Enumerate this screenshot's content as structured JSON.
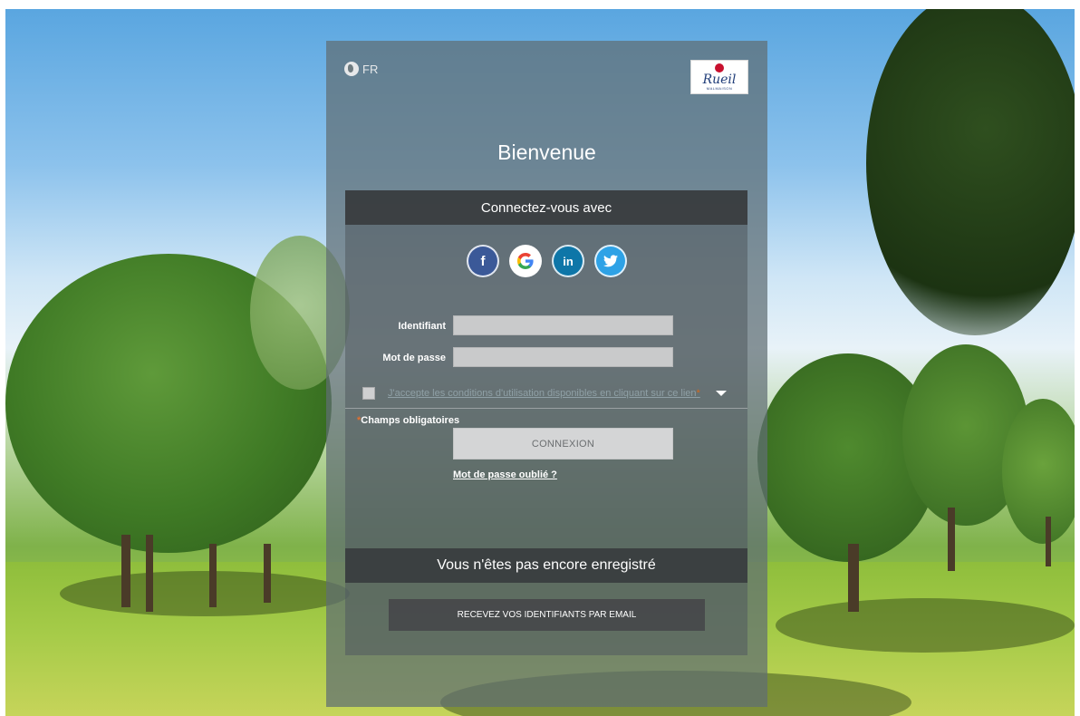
{
  "header": {
    "language": "FR",
    "logo_text": "Rueil",
    "logo_subtext": "MALMAISON"
  },
  "main": {
    "title": "Bienvenue",
    "connect_with": "Connectez-vous avec",
    "social": [
      {
        "name": "facebook",
        "glyph": "f",
        "color": "#3b5998"
      },
      {
        "name": "google",
        "glyph": "G",
        "color": "#ffffff"
      },
      {
        "name": "linkedin",
        "glyph": "in",
        "color": "#0e76a8"
      },
      {
        "name": "twitter",
        "glyph": "🐦",
        "color": "#2ea2e6"
      }
    ]
  },
  "form": {
    "identifiant_label": "Identifiant",
    "identifiant_value": "",
    "password_label": "Mot de passe",
    "password_value": "",
    "terms_text": "J'accepte les conditions d'utilisation disponibles en cliquant sur ce lien",
    "terms_required_mark": "*",
    "required_mark": "*",
    "required_note": "Champs obligatoires",
    "submit_label": "CONNEXION",
    "forgot_label": "Mot de passe oublié ?"
  },
  "register": {
    "title": "Vous n'êtes pas encore enregistré",
    "email_button": "RECEVEZ VOS IDENTIFIANTS PAR EMAIL"
  }
}
